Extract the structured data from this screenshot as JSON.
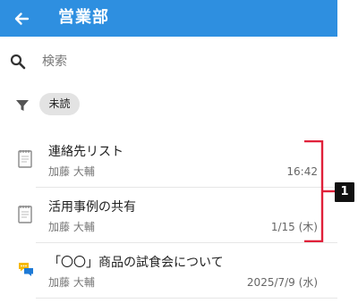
{
  "header": {
    "title": "営業部",
    "back_icon": "arrow-back-icon",
    "background": "#2e8fe0"
  },
  "search": {
    "placeholder": "検索",
    "icon": "search-icon"
  },
  "filter": {
    "icon": "filter-icon",
    "chip_label": "未読"
  },
  "messages": [
    {
      "icon": "notepad-icon",
      "title": "連絡先リスト",
      "sender": "加藤 大輔",
      "date": "16:42"
    },
    {
      "icon": "notepad-icon",
      "title": "活用事例の共有",
      "sender": "加藤 大輔",
      "date": "1/15 (木)"
    },
    {
      "icon": "chat-bubbles-icon",
      "title": "「〇〇」商品の試食会について",
      "sender": "加藤 大輔",
      "date": "2025/7/9 (水)"
    }
  ],
  "annotation": {
    "badge": "1",
    "color": "#e0213a"
  }
}
